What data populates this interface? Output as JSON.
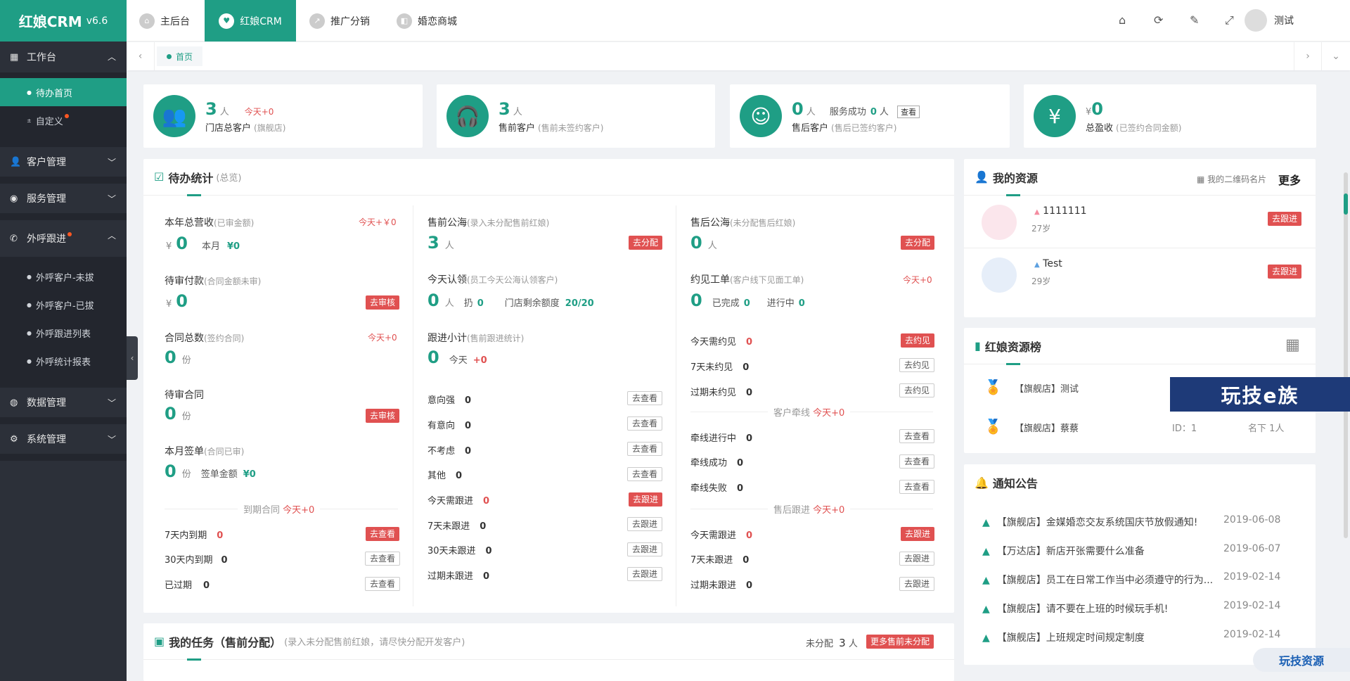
{
  "app": {
    "name": "红娘CRM",
    "version": "v6.6"
  },
  "sidebar": {
    "workbench": "工作台",
    "todo_home": "待办首页",
    "custom": "自定义",
    "customer_mgmt": "客户管理",
    "service_mgmt": "服务管理",
    "outcall": "外呼跟进",
    "outcall_items": [
      "外呼客户-未拔",
      "外呼客户-已拔",
      "外呼跟进列表",
      "外呼统计报表"
    ],
    "data_mgmt": "数据管理",
    "system_mgmt": "系统管理"
  },
  "header": {
    "tabs": [
      "主后台",
      "红娘CRM",
      "推广分销",
      "婚恋商城"
    ],
    "user": "测试",
    "home_tab": "首页"
  },
  "stats": [
    {
      "value": "3",
      "unit": "人",
      "extra": "今天+0",
      "label": "门店总客户",
      "note": "(旗舰店)"
    },
    {
      "value": "3",
      "unit": "人",
      "label": "售前客户",
      "note": "(售前未签约客户)"
    },
    {
      "value": "0",
      "unit": "人",
      "extra_label": "服务成功",
      "extra_value": "0",
      "extra_unit": "人",
      "button": "查看",
      "label": "售后客户",
      "note": "(售后已签约客户)"
    },
    {
      "prefix": "¥",
      "value": "0",
      "label": "总盈收",
      "note": "(已签约合同金额)"
    }
  ],
  "todo": {
    "title": "待办统计",
    "note": "(总览)",
    "c1": {
      "revenue_label": "本年总营收",
      "revenue_note": "(已审金额)",
      "revenue_today": "今天+￥0",
      "revenue_value": "0",
      "month_label": "本月",
      "month_value": "¥0",
      "pending_pay_label": "待审付款",
      "pending_pay_note": "(合同金额未审)",
      "pending_pay_value": "0",
      "audit_btn": "去审核",
      "contracts_label": "合同总数",
      "contracts_note": "(签约合同)",
      "contracts_today": "今天+0",
      "contracts_value": "0",
      "unit_fen": "份",
      "pending_contract_label": "待审合同",
      "pending_contract_value": "0",
      "monthly_label": "本月签单",
      "monthly_note": "(合同已审)",
      "monthly_value": "0",
      "sign_amount_label": "签单金额",
      "sign_amount_value": "¥0",
      "expire_divider": "到期合同",
      "expire_today": "今天+0",
      "expire_7_label": "7天内到期",
      "expire_7_value": "0",
      "btn_view_red": "去查看",
      "expire_30_label": "30天内到期",
      "expire_30_value": "0",
      "btn_view": "去查看",
      "expired_label": "已过期",
      "expired_value": "0"
    },
    "c2": {
      "pool_label": "售前公海",
      "pool_note": "(录入未分配售前红娘)",
      "pool_value": "3",
      "unit": "人",
      "assign_btn": "去分配",
      "claim_label": "今天认领",
      "claim_note": "(员工今天公海认领客户)",
      "claim_value": "0",
      "reng_label": "扔",
      "reng_value": "0",
      "quota_label": "门店剩余额度",
      "quota_value": "20/20",
      "followup_label": "跟进小计",
      "followup_note": "(售前跟进统计)",
      "followup_value": "0",
      "today_label": "今天",
      "today_value": "+0",
      "intent": [
        {
          "label": "意向强",
          "value": "0"
        },
        {
          "label": "有意向",
          "value": "0"
        },
        {
          "label": "不考虑",
          "value": "0"
        },
        {
          "label": "其他",
          "value": "0"
        }
      ],
      "view_btn": "去查看",
      "follow": [
        {
          "label": "今天需跟进",
          "value": "0"
        },
        {
          "label": "7天未跟进",
          "value": "0"
        },
        {
          "label": "30天未跟进",
          "value": "0"
        },
        {
          "label": "过期未跟进",
          "value": "0"
        }
      ],
      "follow_btn": "去跟进"
    },
    "c3": {
      "pool_label": "售后公海",
      "pool_note": "(未分配售后红娘)",
      "pool_value": "0",
      "unit": "人",
      "assign_btn": "去分配",
      "appt_label": "约见工单",
      "appt_note": "(客户线下见面工单)",
      "appt_today": "今天+0",
      "appt_value": "0",
      "done_label": "已完成",
      "done_value": "0",
      "inprog_label": "进行中",
      "inprog_value": "0",
      "meet": [
        {
          "label": "今天需约见",
          "value": "0"
        },
        {
          "label": "7天未约见",
          "value": "0"
        },
        {
          "label": "过期未约见",
          "value": "0"
        }
      ],
      "meet_btn": "去约见",
      "match_divider": "客户牵线",
      "match_today": "今天+0",
      "match": [
        {
          "label": "牵线进行中",
          "value": "0"
        },
        {
          "label": "牵线成功",
          "value": "0"
        },
        {
          "label": "牵线失败",
          "value": "0"
        }
      ],
      "view_btn": "去查看",
      "after_divider": "售后跟进",
      "after_today": "今天+0",
      "after": [
        {
          "label": "今天需跟进",
          "value": "0"
        },
        {
          "label": "7天未跟进",
          "value": "0"
        },
        {
          "label": "过期未跟进",
          "value": "0"
        }
      ],
      "follow_btn": "去跟进"
    }
  },
  "resources": {
    "title": "我的资源",
    "qr_link": "我的二维码名片",
    "more": "更多",
    "btn": "去跟进",
    "items": [
      {
        "name": "1111111",
        "age": "27岁"
      },
      {
        "name": "Test",
        "age": "29岁"
      }
    ]
  },
  "ranking": {
    "title": "红娘资源榜",
    "items": [
      {
        "name": "【旗舰店】测试"
      },
      {
        "name": "【旗舰店】蔡蔡",
        "id": "ID：1",
        "count": "名下 1人"
      }
    ]
  },
  "notices": {
    "title": "通知公告",
    "items": [
      {
        "text": "【旗舰店】金媒婚恋交友系统国庆节放假通知!",
        "date": "2019-06-08"
      },
      {
        "text": "【万达店】新店开张需要什么准备",
        "date": "2019-06-07"
      },
      {
        "text": "【旗舰店】员工在日常工作当中必须遵守的行为...",
        "date": "2019-02-14"
      },
      {
        "text": "【旗舰店】请不要在上班的时候玩手机!",
        "date": "2019-02-14"
      },
      {
        "text": "【旗舰店】上班规定时间规定制度",
        "date": "2019-02-14"
      }
    ]
  },
  "tasks": {
    "title": "我的任务（售前分配）",
    "note": "(录入未分配售前红娘，请尽快分配开发客户)",
    "unassigned_label": "未分配",
    "unassigned_value": "3",
    "unit": "人",
    "btn": "更多售前未分配"
  },
  "watermark": "玩技e族",
  "watermark2": "玩技资源"
}
